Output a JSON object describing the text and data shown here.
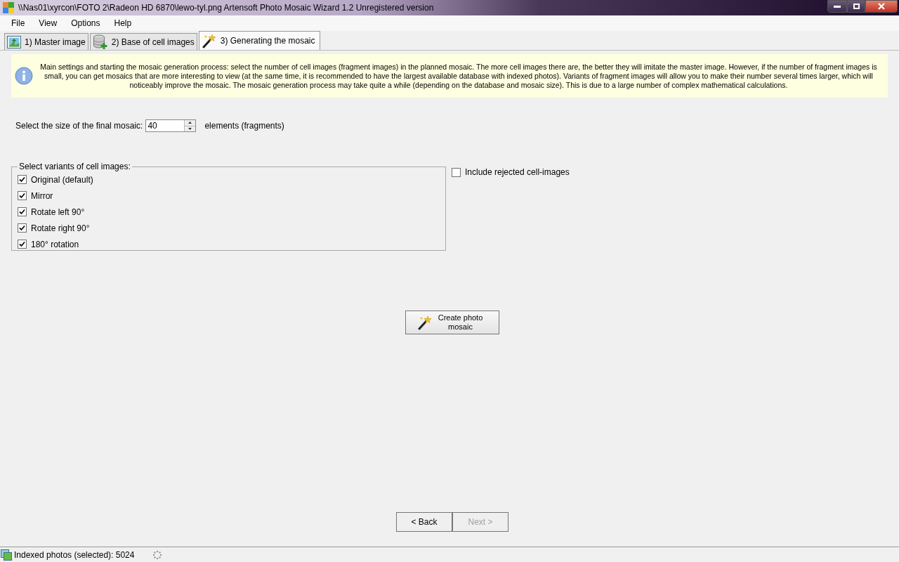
{
  "window": {
    "title": "\\\\Nas01\\xyrcon\\FOTO 2\\Radeon HD 6870\\lewo-tyl.png Artensoft Photo Mosaic Wizard 1.2  Unregistered version"
  },
  "menu": [
    "File",
    "View",
    "Options",
    "Help"
  ],
  "tabs": [
    {
      "label": "1) Master image",
      "kind": "picture",
      "selected": false
    },
    {
      "label": "2) Base of cell images",
      "kind": "database",
      "selected": false
    },
    {
      "label": "3) Generating the mosaic",
      "kind": "wand",
      "selected": true
    }
  ],
  "info": "Main settings and starting the mosaic generation process: select the number of cell images (fragment images) in the planned mosaic. The more cell images there are, the better they will imitate the master image. However, if the number of fragment images is small, you can get mosaics that are more interesting to view (at the same time, it is recommended to have the largest available database with indexed photos). Variants of fragment images will allow you to make their number several times larger, which will noticeably improve the mosaic. The mosaic generation process may take quite a while (depending on the database and mosaic size). This is due to a large number of complex mathematical calculations.",
  "size": {
    "label": "Select the size of the final mosaic:",
    "value": "40",
    "unit": "elements (fragments)"
  },
  "variants": {
    "title": "Select variants of cell images:",
    "items": [
      {
        "label": "Original (default)",
        "checked": true
      },
      {
        "label": "Mirror",
        "checked": true
      },
      {
        "label": "Rotate left 90°",
        "checked": true
      },
      {
        "label": "Rotate right 90°",
        "checked": true
      },
      {
        "label": "180° rotation",
        "checked": true
      }
    ]
  },
  "include_rejected": {
    "label": "Include rejected cell-images",
    "checked": false
  },
  "create_button": {
    "label": "Create photo mosaic"
  },
  "nav": [
    {
      "label": "< Back",
      "disabled": false
    },
    {
      "label": "Next >",
      "disabled": true
    }
  ],
  "status_bar": {
    "text": "Indexed photos (selected): 5024"
  }
}
